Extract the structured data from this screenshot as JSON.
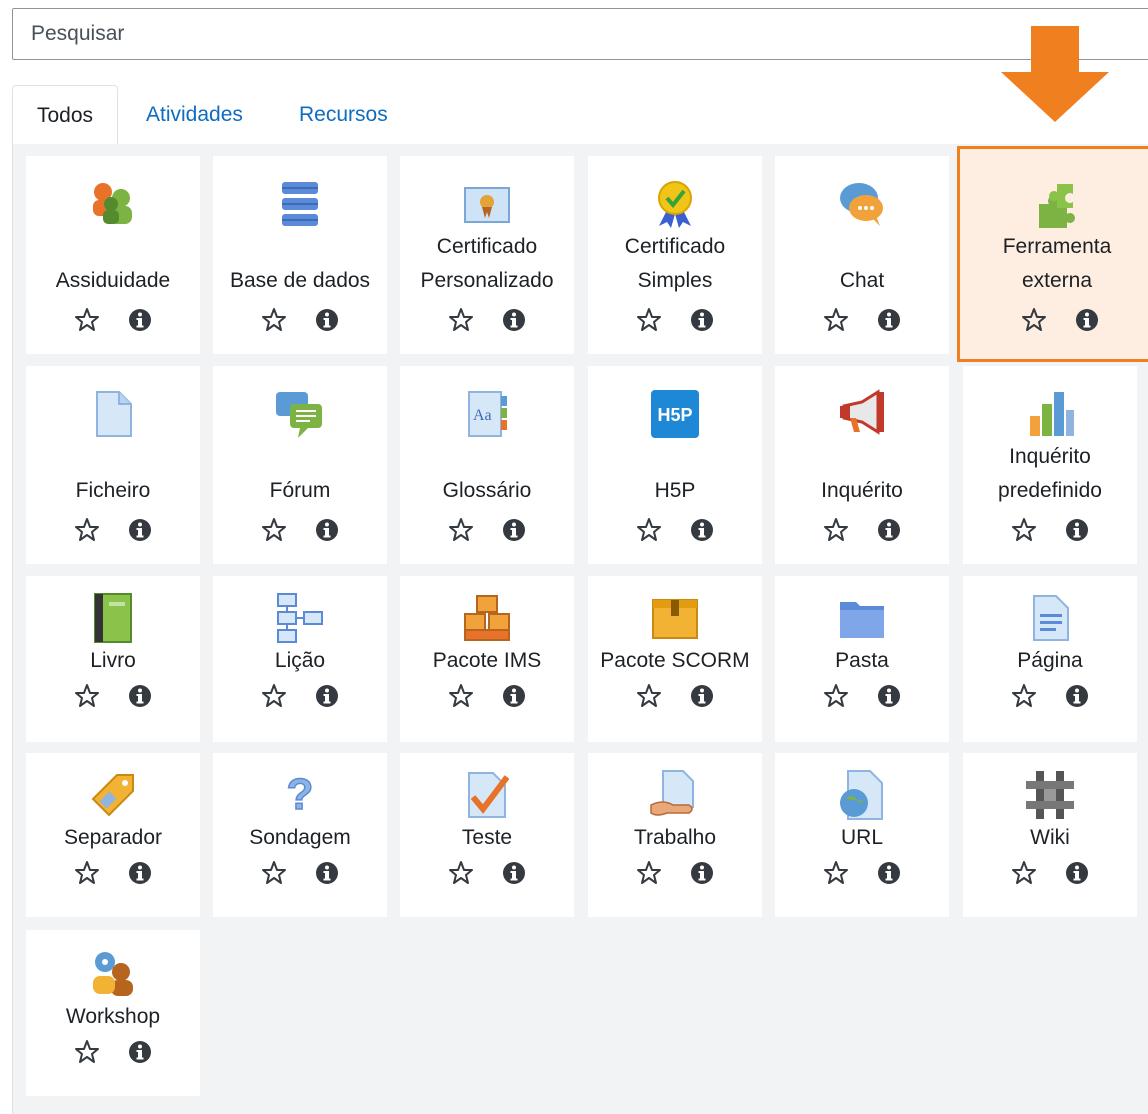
{
  "search": {
    "placeholder": "Pesquisar"
  },
  "tabs": [
    {
      "label": "Todos",
      "active": true
    },
    {
      "label": "Atividades",
      "active": false
    },
    {
      "label": "Recursos",
      "active": false
    }
  ],
  "highlight_color": "#f07f1f",
  "modules": [
    {
      "name": "Assiduidade",
      "icon": "attendance-icon"
    },
    {
      "name": "Base de dados",
      "icon": "database-icon"
    },
    {
      "name": "Certificado Personalizado",
      "lines": [
        "Certificado",
        "Personalizado"
      ],
      "icon": "custom-certificate-icon"
    },
    {
      "name": "Certificado Simples",
      "lines": [
        "Certificado",
        "Simples"
      ],
      "icon": "simple-certificate-icon"
    },
    {
      "name": "Chat",
      "icon": "chat-icon"
    },
    {
      "name": "Ferramenta externa",
      "lines": [
        "Ferramenta",
        "externa"
      ],
      "icon": "puzzle-piece-icon",
      "highlighted": true
    },
    {
      "name": "Ficheiro",
      "icon": "file-icon"
    },
    {
      "name": "Fórum",
      "icon": "forum-icon"
    },
    {
      "name": "Glossário",
      "icon": "glossary-icon"
    },
    {
      "name": "H5P",
      "icon": "h5p-icon"
    },
    {
      "name": "Inquérito",
      "icon": "megaphone-icon"
    },
    {
      "name": "Inquérito predefinido",
      "lines": [
        "Inquérito",
        "predefinido"
      ],
      "icon": "bar-chart-icon"
    },
    {
      "name": "Livro",
      "icon": "book-icon"
    },
    {
      "name": "Lição",
      "icon": "lesson-icon"
    },
    {
      "name": "Pacote IMS",
      "icon": "ims-package-icon"
    },
    {
      "name": "Pacote SCORM",
      "icon": "scorm-package-icon"
    },
    {
      "name": "Pasta",
      "icon": "folder-icon"
    },
    {
      "name": "Página",
      "icon": "page-icon"
    },
    {
      "name": "Separador",
      "icon": "label-tag-icon"
    },
    {
      "name": "Sondagem",
      "icon": "question-mark-icon"
    },
    {
      "name": "Teste",
      "icon": "quiz-checkmark-icon"
    },
    {
      "name": "Trabalho",
      "icon": "assignment-icon"
    },
    {
      "name": "URL",
      "icon": "url-globe-icon"
    },
    {
      "name": "Wiki",
      "icon": "wiki-icon"
    },
    {
      "name": "Workshop",
      "icon": "workshop-icon"
    }
  ]
}
